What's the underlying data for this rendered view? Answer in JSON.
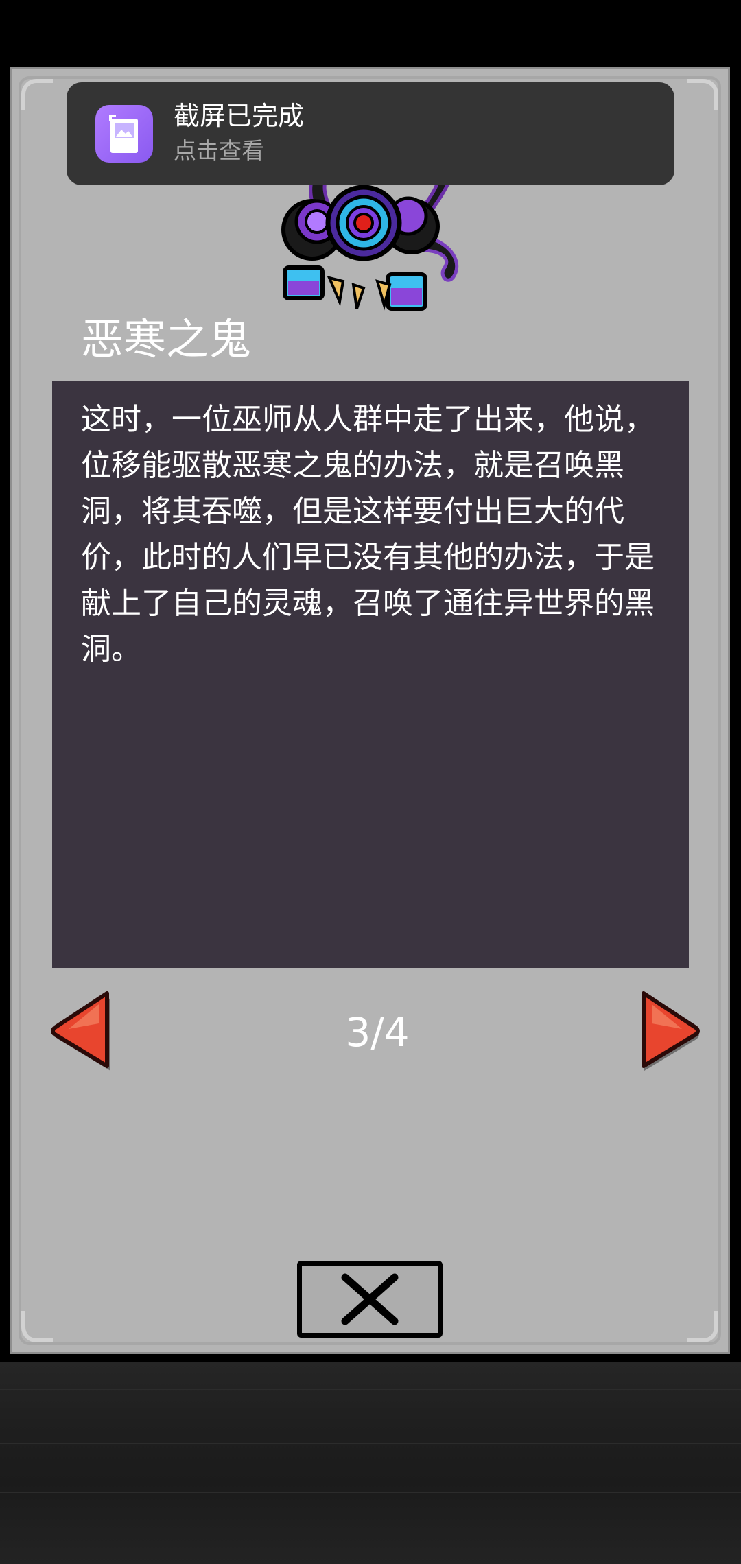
{
  "notification": {
    "icon": "screenshot-gallery-icon",
    "title": "截屏已完成",
    "subtitle": "点击查看"
  },
  "dialog": {
    "monster_image": "purple-eye-ghost-monster",
    "title": "恶寒之鬼",
    "story": "这时，一位巫师从人群中走了出来，他说，位移能驱散恶寒之鬼的办法，就是召唤黑洞，将其吞噬，但是这样要付出巨大的代价，此时的人们早已没有其他的办法，于是献上了自己的灵魂，召唤了通往异世界的黑洞。",
    "pagination": {
      "current": 3,
      "total": 4,
      "label": "3/4",
      "prev_icon": "red-arrow-left-icon",
      "next_icon": "red-arrow-right-icon"
    },
    "close_icon": "close-x-icon"
  },
  "colors": {
    "panel": "#b4b4b4",
    "story_box": "#3b3440",
    "arrow": "#e8452e",
    "toast": "#343434",
    "toast_icon": "#9b6cf6"
  }
}
